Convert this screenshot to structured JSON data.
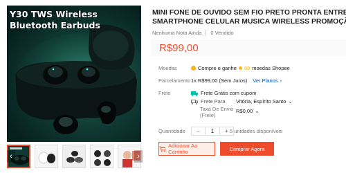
{
  "gallery": {
    "caption_line1": "Y30 TWS Wireless",
    "caption_line2": "Bluetooth Earbuds",
    "prev_arrow": "‹",
    "next_arrow": "›"
  },
  "product": {
    "title_line1": "MINI FONE DE OUVIDO SEM FIO PRETO PRONTA ENTREGA",
    "title_line2": "SMARTPHONE CELULAR MUSICA WIRELESS PROMOÇÃO ESPORTIVO...",
    "rating": "Nenhuma Nota Ainda",
    "sold": "0 Vendido",
    "price": "R$99,00"
  },
  "coins": {
    "label": "Moedas",
    "text_before": "Compre e ganhe",
    "amount": "99",
    "text_after": "moedas Shopee"
  },
  "installment": {
    "label": "Parcelamento",
    "text": "1x R$99,00 (Sem Juros)",
    "link": "Ver Planos",
    "chevron": "›"
  },
  "shipping": {
    "label": "Frete",
    "free": "Frete Grátis com cupom",
    "to_label": "Frete Para",
    "destination": "Vitória, Espírito Santo",
    "fee_label_line1": "Taxa De Envio",
    "fee_label_line2": "(Frete)",
    "fee": "R$0,00",
    "chevron": "⌄"
  },
  "quantity": {
    "label": "Quantidade",
    "minus": "−",
    "value": "1",
    "plus": "+",
    "available": "5 unidades disponíveis"
  },
  "actions": {
    "add_to_cart": "Adicionar Ao Carrinho",
    "buy_now": "Comprar Agora"
  },
  "colors": {
    "accent": "#ee4d2d",
    "accent_light": "#ffeee8",
    "coin": "#f6b41b",
    "shipping_green": "#00bfa5",
    "link": "#0055aa"
  }
}
